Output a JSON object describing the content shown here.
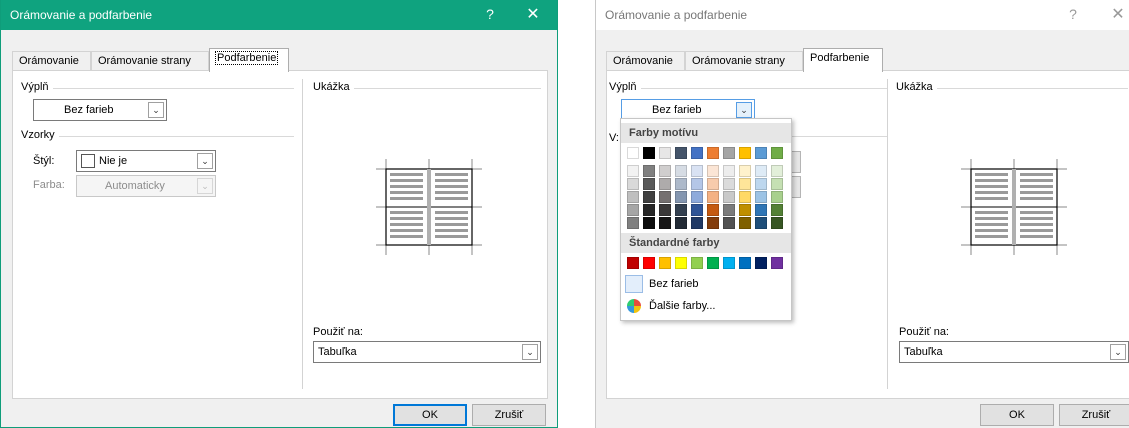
{
  "dialog_title": "Orámovanie a podfarbenie",
  "help_glyph": "?",
  "close_glyph": "✕",
  "tabs": [
    {
      "label": "Orámovanie"
    },
    {
      "label": "Orámovanie strany"
    },
    {
      "label": "Podfarbenie"
    }
  ],
  "fill": {
    "group_label": "Výplň",
    "value": "Bez farieb"
  },
  "patterns": {
    "group_label": "Vzorky",
    "style_label": "Štýl:",
    "style_value": "Nie je",
    "color_label": "Farba:",
    "color_value": "Automaticky"
  },
  "preview": {
    "group_label": "Ukážka"
  },
  "apply_to": {
    "label": "Použiť na:",
    "value": "Tabuľka"
  },
  "buttons": {
    "ok": "OK",
    "cancel": "Zrušiť"
  },
  "left_panel_stub": "V:",
  "palette": {
    "theme_header": "Farby motívu",
    "standard_header": "Štandardné farby",
    "no_color": "Bez farieb",
    "more_colors": "Ďalšie farby...",
    "theme_top_row": [
      "#ffffff",
      "#000000",
      "#e7e6e6",
      "#44546a",
      "#4472c4",
      "#ed7d31",
      "#a5a5a5",
      "#ffc000",
      "#5b9bd5",
      "#70ad47"
    ],
    "theme_tints": [
      [
        "#f2f2f2",
        "#808080",
        "#d0cece",
        "#d6dce4",
        "#d9e2f3",
        "#fbe5d5",
        "#ededed",
        "#fff2cc",
        "#deebf6",
        "#e2efd9"
      ],
      [
        "#d9d9d9",
        "#595959",
        "#aeabab",
        "#adb9ca",
        "#b4c6e7",
        "#f7cbac",
        "#dbdbdb",
        "#fee599",
        "#bdd7ee",
        "#c5e0b3"
      ],
      [
        "#bfbfbf",
        "#404040",
        "#757070",
        "#8496b0",
        "#8eaadb",
        "#f4b183",
        "#c9c9c9",
        "#ffd965",
        "#9cc3e5",
        "#a8d08d"
      ],
      [
        "#a6a6a6",
        "#262626",
        "#3a3838",
        "#323f4f",
        "#2f5496",
        "#c55a11",
        "#7b7b7b",
        "#bf8f00",
        "#2e75b5",
        "#538135"
      ],
      [
        "#808080",
        "#0d0d0d",
        "#171616",
        "#222a35",
        "#1f3864",
        "#833c0b",
        "#525252",
        "#7f6000",
        "#1e4e79",
        "#375623"
      ]
    ],
    "standard_colors": [
      "#c00000",
      "#ff0000",
      "#ffc000",
      "#ffff00",
      "#92d050",
      "#00b050",
      "#00b0f0",
      "#0070c0",
      "#002060",
      "#7030a0"
    ]
  }
}
